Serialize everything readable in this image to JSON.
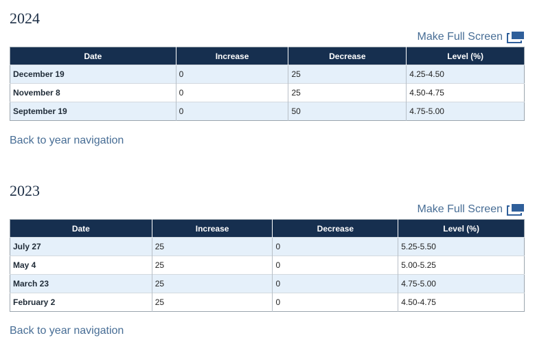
{
  "fullscreen_label": "Make Full Screen",
  "back_label": "Back to year navigation",
  "columns": [
    "Date",
    "Increase",
    "Decrease",
    "Level (%)"
  ],
  "sections": [
    {
      "year": "2024",
      "rows": [
        [
          "December 19",
          "0",
          "25",
          "4.25-4.50"
        ],
        [
          "November 8",
          "0",
          "25",
          "4.50-4.75"
        ],
        [
          "September 19",
          "0",
          "50",
          "4.75-5.00"
        ]
      ]
    },
    {
      "year": "2023",
      "rows": [
        [
          "July 27",
          "25",
          "0",
          "5.25-5.50"
        ],
        [
          "May 4",
          "25",
          "0",
          "5.00-5.25"
        ],
        [
          "March 23",
          "25",
          "0",
          "4.75-5.00"
        ],
        [
          "February 2",
          "25",
          "0",
          "4.50-4.75"
        ]
      ]
    }
  ]
}
